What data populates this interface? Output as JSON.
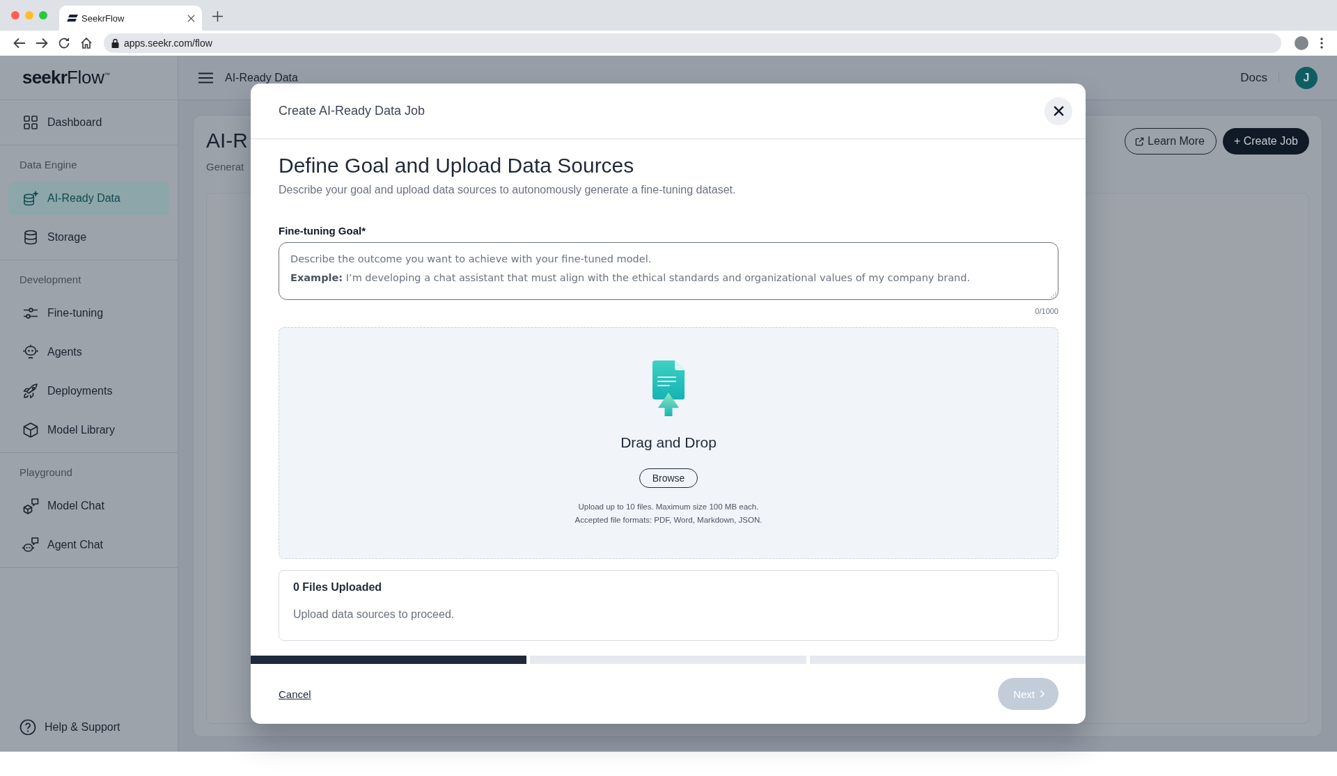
{
  "browser": {
    "tab_title": "SeekrFlow",
    "url": "apps.seekr.com/flow"
  },
  "sidebar": {
    "logo": "**seekr**Flow$^{™}$",
    "sections": [
      {
        "items": [
          {
            "label": "Dashboard",
            "selected": false
          }
        ]
      },
      {
        "heading": "Data Engine",
        "items": [
          {
            "label": "AI-Ready Data",
            "selected": true
          },
          {
            "label": "Storage",
            "selected": false
          }
        ]
      },
      {
        "heading": "Development",
        "items": [
          {
            "label": "Fine-tuning",
            "selected": false
          },
          {
            "label": "Agents",
            "selected": false
          },
          {
            "label": "Deployments",
            "selected": false
          },
          {
            "label": "Model Library",
            "selected": false
          }
        ]
      },
      {
        "heading": "Playground",
        "items": [
          {
            "label": "Model Chat",
            "selected": false
          },
          {
            "label": "Agent Chat",
            "selected": false
          }
        ]
      }
    ],
    "footer": "Help & Support"
  },
  "header": {
    "title": "AI-Ready Data",
    "links": [
      "Docs"
    ],
    "avatar": "J"
  },
  "page": {
    "title": "AI-R",
    "subtitle": "Generat",
    "buttons": [
      {
        "label": "Learn More",
        "kind": "outline"
      },
      {
        "label": "+ Create Job",
        "kind": "primary"
      }
    ]
  },
  "modal": {
    "title": "Create AI-Ready Data Job",
    "heading": "Define Goal and Upload Data Sources",
    "description": "Describe your goal and upload data sources to autonomously generate a fine-tuning dataset.",
    "goal": {
      "label": "Fine-tuning Goal*",
      "placeholder": "Describe the outcome you want to achieve with your fine-tuned model.\n**Example:** I’m developing a chat assistant that must align with the ethical standards and organizational values of my company brand.",
      "counter": "0/1000"
    },
    "dropzone": {
      "title": "Drag and Drop",
      "button": "Browse",
      "hint": "Upload up to 10 files. Maximum size 100 MB each.\nAccepted file formats: PDF, Word, Markdown, JSON."
    },
    "files": {
      "title": "0 Files Uploaded",
      "message": "Upload data sources to proceed."
    },
    "steps": [
      {
        "complete": true
      },
      {
        "complete": false
      },
      {
        "complete": false
      }
    ],
    "cancel": "Cancel",
    "next": {
      "label": "Next",
      "disabled": true
    }
  }
}
